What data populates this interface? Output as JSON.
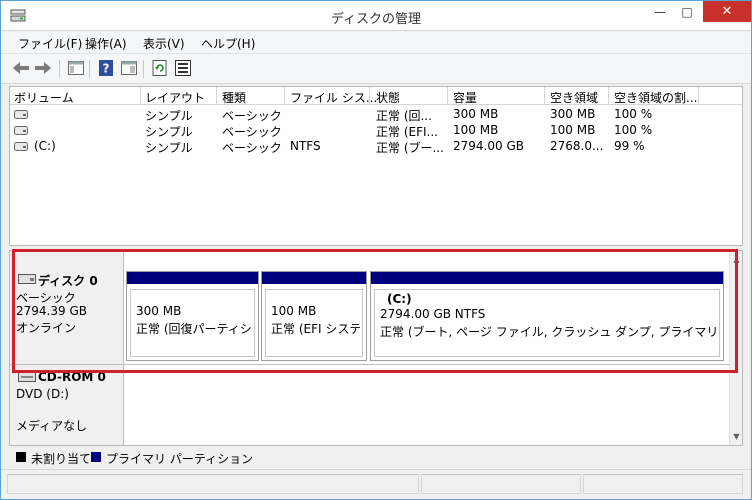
{
  "window": {
    "title": "ディスクの管理"
  },
  "titlebar": {
    "minimize_icon": "minimize-icon",
    "maximize_icon": "maximize-icon",
    "close_icon": "close-icon"
  },
  "menu": {
    "items": [
      {
        "label": "ファイル(F)"
      },
      {
        "label": "操作(A)"
      },
      {
        "label": "表示(V)"
      },
      {
        "label": "ヘルプ(H)"
      }
    ]
  },
  "toolbar": {
    "icons": [
      "back-arrow-icon",
      "forward-arrow-icon",
      "console-tree-icon",
      "help-icon",
      "properties-icon",
      "refresh-icon",
      "export-list-icon"
    ]
  },
  "volume_list": {
    "columns": [
      "ボリューム",
      "レイアウト",
      "種類",
      "ファイル シス...",
      "状態",
      "容量",
      "空き領域",
      "空き領域の割..."
    ],
    "rows": [
      {
        "volume": "",
        "layout": "シンプル",
        "type": "ベーシック",
        "fs": "",
        "status": "正常 (回...",
        "capacity": "300 MB",
        "free": "300 MB",
        "pct": "100 %"
      },
      {
        "volume": "",
        "layout": "シンプル",
        "type": "ベーシック",
        "fs": "",
        "status": "正常 (EFI...",
        "capacity": "100 MB",
        "free": "100 MB",
        "pct": "100 %"
      },
      {
        "volume": "(C:)",
        "layout": "シンプル",
        "type": "ベーシック",
        "fs": "NTFS",
        "status": "正常 (ブー...",
        "capacity": "2794.00 GB",
        "free": "2768.0...",
        "pct": "99 %"
      }
    ]
  },
  "disks": [
    {
      "name": "ディスク 0",
      "kind": "ベーシック",
      "size": "2794.39 GB",
      "state": "オンライン",
      "partitions": [
        {
          "title": "",
          "size": "300 MB",
          "status": "正常 (回復パーティション"
        },
        {
          "title": "",
          "size": "100 MB",
          "status": "正常 (EFI システム"
        },
        {
          "title": "(C:)",
          "size": "2794.00 GB NTFS",
          "status": "正常 (ブート, ページ ファイル, クラッシュ ダンプ, プライマリ パーティション)"
        }
      ]
    },
    {
      "name": "CD-ROM 0",
      "kind": "DVD (D:)",
      "size": "",
      "state": "メディアなし"
    }
  ],
  "legend": {
    "unallocated": "未割り当て",
    "primary": "プライマリ パーティション",
    "unallocated_color": "#000000",
    "primary_color": "#00007f"
  },
  "colors": {
    "partition_bar": "#00007f",
    "highlight": "#d0202a",
    "close_button": "#c7302b"
  }
}
